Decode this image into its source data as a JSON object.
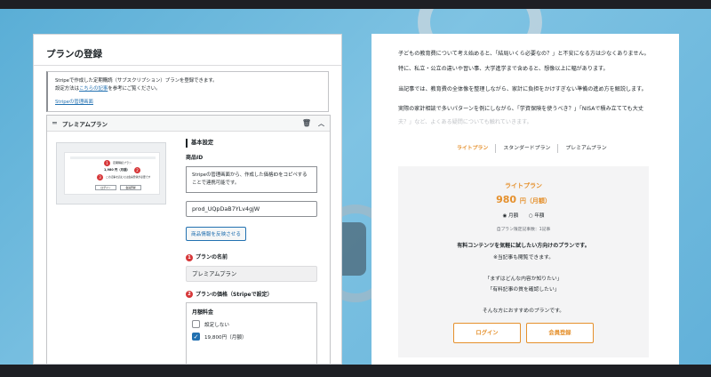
{
  "admin": {
    "page_title": "プランの登録",
    "notice_line1": "Stripeで作成した定期購読（サブスクリプション）プランを登録できます。",
    "notice_line2_pre": "設定方法は",
    "notice_link": "こちらの記事",
    "notice_line2_post": "を参考にご覧ください。",
    "stripe_mgmt_link": "Stripeの管理画面",
    "plan_card_title": "プレミアムプラン",
    "basic_settings": "基本設定",
    "product_id_label": "商品ID",
    "product_id_desc": "Stripeの管理画面から、作成した価格IDをコピペすることで連携可能です。",
    "product_id_value": "prod_UQpDaB7YLv4gjW",
    "reflect_button": "商品情報を反映させる",
    "plan_name_label": "プランの名前",
    "plan_name_value": "プレミアムプラン",
    "plan_price_label": "プランの価格（Stripeで設定）",
    "monthly_fee_label": "月額料金",
    "option_none": "設定しない",
    "option_price": "19,800円（月額）",
    "icons": {
      "drag": "drag-handle-icon",
      "trash": "trash-icon",
      "collapse": "chevron-up-icon",
      "check": "checkmark-icon"
    },
    "thumbnail": {
      "plan_label": "定期購読プラン",
      "price": "1,980 円（月額）",
      "note": "この記事を読むには会員登録が必要です",
      "btn_left": "ログイン",
      "btn_right": "会員登録"
    }
  },
  "preview": {
    "para1": "子どもの教育費について考え始めると、「結局いくら必要なの？」と不安になる方は少なくありません。",
    "para2": "特に、私立・公立の違いや習い事、大学進学まで含めると、想像以上に幅があります。",
    "para3": "当記事では、教育費の全体像を整理しながら、家計に負担をかけすぎない準備の進め方を解説します。",
    "para4a": "実際の家計相談で多いパターンを例にしながら、「学資保険を使うべき？」「NISAで積み立てても大丈",
    "para4b": "夫？」など、よくある疑問についても触れていきます。",
    "tabs": [
      "ライトプラン",
      "スタンダードプラン",
      "プレミアムプラン"
    ],
    "active_tab": 0,
    "card": {
      "plan_name": "ライトプラン",
      "price": "980",
      "unit": "円（月額）",
      "radio_monthly": "◉ 月額",
      "radio_yearly": "○ 年額",
      "limit": "自プラン限定記事数：1記事",
      "lead": "有料コンテンツを気軽に試したい方向けのプランです。",
      "sub": "※当記事も閲覧できます。",
      "q1": "「まずはどんな内容か知りたい」",
      "q2": "「有料記事の質を確認したい」",
      "closing": "そんな方におすすめのプランです。",
      "login": "ログイン",
      "register": "会員登録"
    }
  },
  "colors": {
    "accent": "#e5902c",
    "link": "#2271b1",
    "badge": "#d63638",
    "background": "#6bb8de"
  }
}
